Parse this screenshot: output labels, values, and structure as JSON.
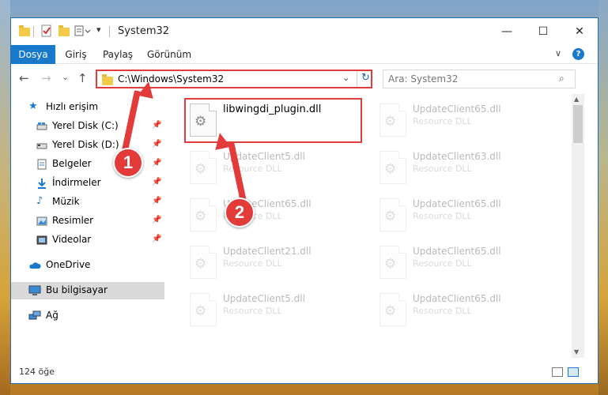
{
  "window": {
    "title": "System32",
    "controls": {
      "minimize": "—",
      "maximize": "☐",
      "close": "✕"
    }
  },
  "ribbon": {
    "tabs": [
      {
        "label": "Dosya",
        "active": true
      },
      {
        "label": "Giriş"
      },
      {
        "label": "Paylaş"
      },
      {
        "label": "Görünüm"
      }
    ],
    "expand": "∨",
    "help": "?"
  },
  "navigation": {
    "back": "←",
    "forward": "→",
    "recent": "⌄",
    "up": "↑",
    "address": "C:\\Windows\\System32",
    "address_chevron": "⌄",
    "refresh": "↻",
    "search_placeholder": "Ara: System32"
  },
  "sidebar": {
    "items": [
      {
        "label": "Hızlı erişim",
        "icon": "star-icon",
        "pinned": false
      },
      {
        "label": "Yerel Disk (C:)",
        "icon": "drive-icon",
        "pinned": true
      },
      {
        "label": "Yerel Disk (D:)",
        "icon": "drive-icon",
        "pinned": true
      },
      {
        "label": "Belgeler",
        "icon": "documents-icon",
        "pinned": true
      },
      {
        "label": "İndirmeler",
        "icon": "download-icon",
        "pinned": true
      },
      {
        "label": "Müzik",
        "icon": "music-icon",
        "pinned": true
      },
      {
        "label": "Resimler",
        "icon": "pictures-icon",
        "pinned": true
      },
      {
        "label": "Videolar",
        "icon": "videos-icon",
        "pinned": true
      },
      {
        "label": "OneDrive",
        "icon": "cloud-icon",
        "pinned": false
      },
      {
        "label": "Bu bilgisayar",
        "icon": "computer-icon",
        "pinned": false,
        "selected": true
      },
      {
        "label": "Ağ",
        "icon": "network-icon",
        "pinned": false
      }
    ]
  },
  "files": [
    {
      "name": "libwingdi_plugin.dll",
      "type": ""
    },
    {
      "name": "UpdateClient65.dll",
      "type": "Resource DLL"
    },
    {
      "name": "UpdateClient5.dll",
      "type": "Resource DLL"
    },
    {
      "name": "UpdateClient63.dll",
      "type": "Resource DLL"
    },
    {
      "name": "UpdateClient65.dll",
      "type": "Resource DLL"
    },
    {
      "name": "UpdateClient65.dll",
      "type": "Resource DLL"
    },
    {
      "name": "UpdateClient21.dll",
      "type": "Resource DLL"
    },
    {
      "name": "UpdateClient65.dll",
      "type": "Resource DLL"
    },
    {
      "name": "UpdateClient5.dll",
      "type": "Resource DLL"
    },
    {
      "name": "UpdateClient65.dll",
      "type": "Resource DLL"
    }
  ],
  "status": {
    "item_count": "124 öğe"
  },
  "annotations": {
    "step1": "1",
    "step2": "2"
  },
  "colors": {
    "accent": "#1979ca",
    "annotation": "#e23b39"
  }
}
